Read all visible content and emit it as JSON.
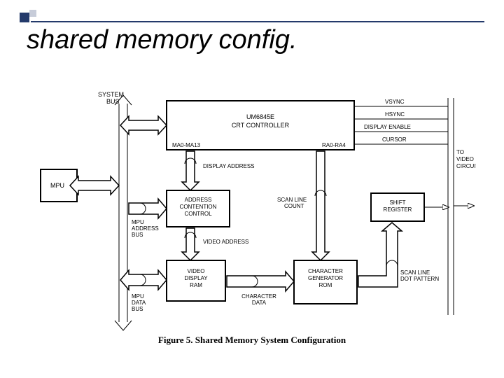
{
  "title": "shared memory config.",
  "caption": "Figure 5. Shared Memory System Configuration",
  "labels": {
    "system_bus": "SYSTEM\nBUS",
    "mpu": "MPU",
    "crt_ctrl_line1": "UM6845E",
    "crt_ctrl_line2": "CRT CONTROLLER",
    "ma_range": "MA0-MA13",
    "ra_range": "RA0-RA4",
    "vsync": "VSYNC",
    "hsync": "HSYNC",
    "display_enable": "DISPLAY ENABLE",
    "cursor": "CURSOR",
    "to_video": "TO\nVIDEO\nCIRCUITS",
    "display_address": "DISPLAY ADDRESS",
    "addr_contention": "ADDRESS\nCONTENTION\nCONTROL",
    "mpu_addr_bus": "MPU\nADDRESS\nBUS",
    "video_address": "VIDEO ADDRESS",
    "video_ram": "VIDEO\nDISPLAY\nRAM",
    "mpu_data_bus": "MPU\nDATA\nBUS",
    "character_data": "CHARACTER\nDATA",
    "scan_line_count": "SCAN LINE\nCOUNT",
    "char_gen": "CHARACTER\nGENERATOR\nROM",
    "shift_reg": "SHIFT\nREGISTER",
    "scan_line_dot": "SCAN LINE\nDOT PATTERN"
  }
}
